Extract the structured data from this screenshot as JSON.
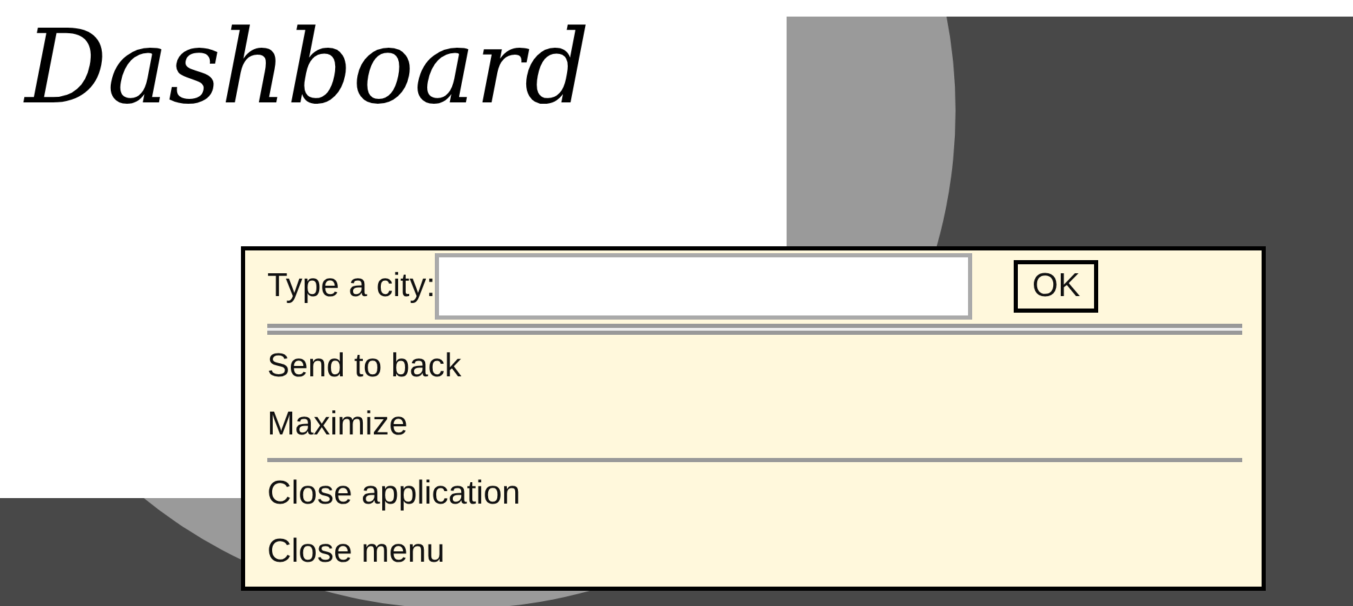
{
  "title": "Dashboard",
  "context_menu": {
    "city_label": "Type a city:",
    "ok_button": "OK",
    "groups": [
      [
        "Send to back",
        "Maximize"
      ],
      [
        "Close application",
        "Close menu"
      ]
    ]
  }
}
